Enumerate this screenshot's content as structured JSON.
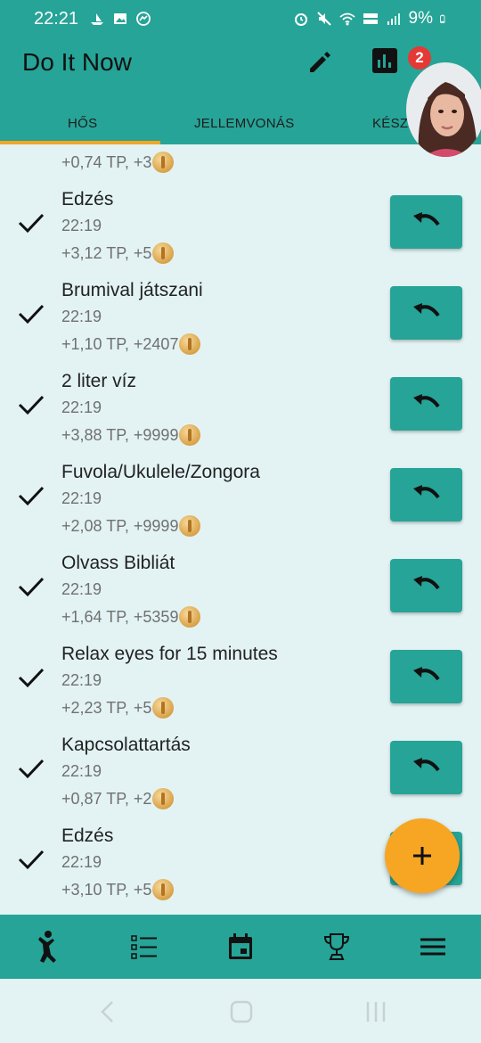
{
  "status_bar": {
    "time": "22:21",
    "battery": "9%",
    "left_icons": [
      "boat-icon",
      "image-icon",
      "messenger-icon"
    ],
    "right_icons": [
      "alarm-icon",
      "mute-icon",
      "wifi-icon",
      "volte-icon",
      "signal-icon",
      "battery-icon"
    ]
  },
  "app": {
    "title": "Do It Now",
    "notification_count": "2"
  },
  "tabs": [
    {
      "label": "HŐS"
    },
    {
      "label": "JELLEMVONÁS"
    },
    {
      "label": "KÉSZSÉG"
    }
  ],
  "partial_item": {
    "reward": "+0,74 TP, +3"
  },
  "items": [
    {
      "title": "Edzés",
      "time": "22:19",
      "reward": "+3,12 TP, +5"
    },
    {
      "title": "Brumival játszani",
      "time": "22:19",
      "reward": "+1,10 TP, +2407"
    },
    {
      "title": "2 liter víz",
      "time": "22:19",
      "reward": "+3,88 TP, +9999"
    },
    {
      "title": "Fuvola/Ukulele/Zongora",
      "time": "22:19",
      "reward": "+2,08 TP, +9999"
    },
    {
      "title": "Olvass Bibliát",
      "time": "22:19",
      "reward": "+1,64 TP, +5359"
    },
    {
      "title": "Relax eyes for 15 minutes",
      "time": "22:19",
      "reward": "+2,23 TP, +5"
    },
    {
      "title": "Kapcsolattartás",
      "time": "22:19",
      "reward": "+0,87 TP, +2"
    },
    {
      "title": "Edzés",
      "time": "22:19",
      "reward": "+3,10 TP, +5"
    }
  ],
  "bottom_nav": [
    {
      "icon": "hero-icon",
      "active": true
    },
    {
      "icon": "list-icon",
      "active": false
    },
    {
      "icon": "calendar-icon",
      "active": false
    },
    {
      "icon": "trophy-icon",
      "active": false
    },
    {
      "icon": "menu-icon",
      "active": false
    }
  ],
  "colors": {
    "primary": "#26a497",
    "accent": "#f6a623",
    "background": "#e3f3f3",
    "badge": "#e53935"
  }
}
